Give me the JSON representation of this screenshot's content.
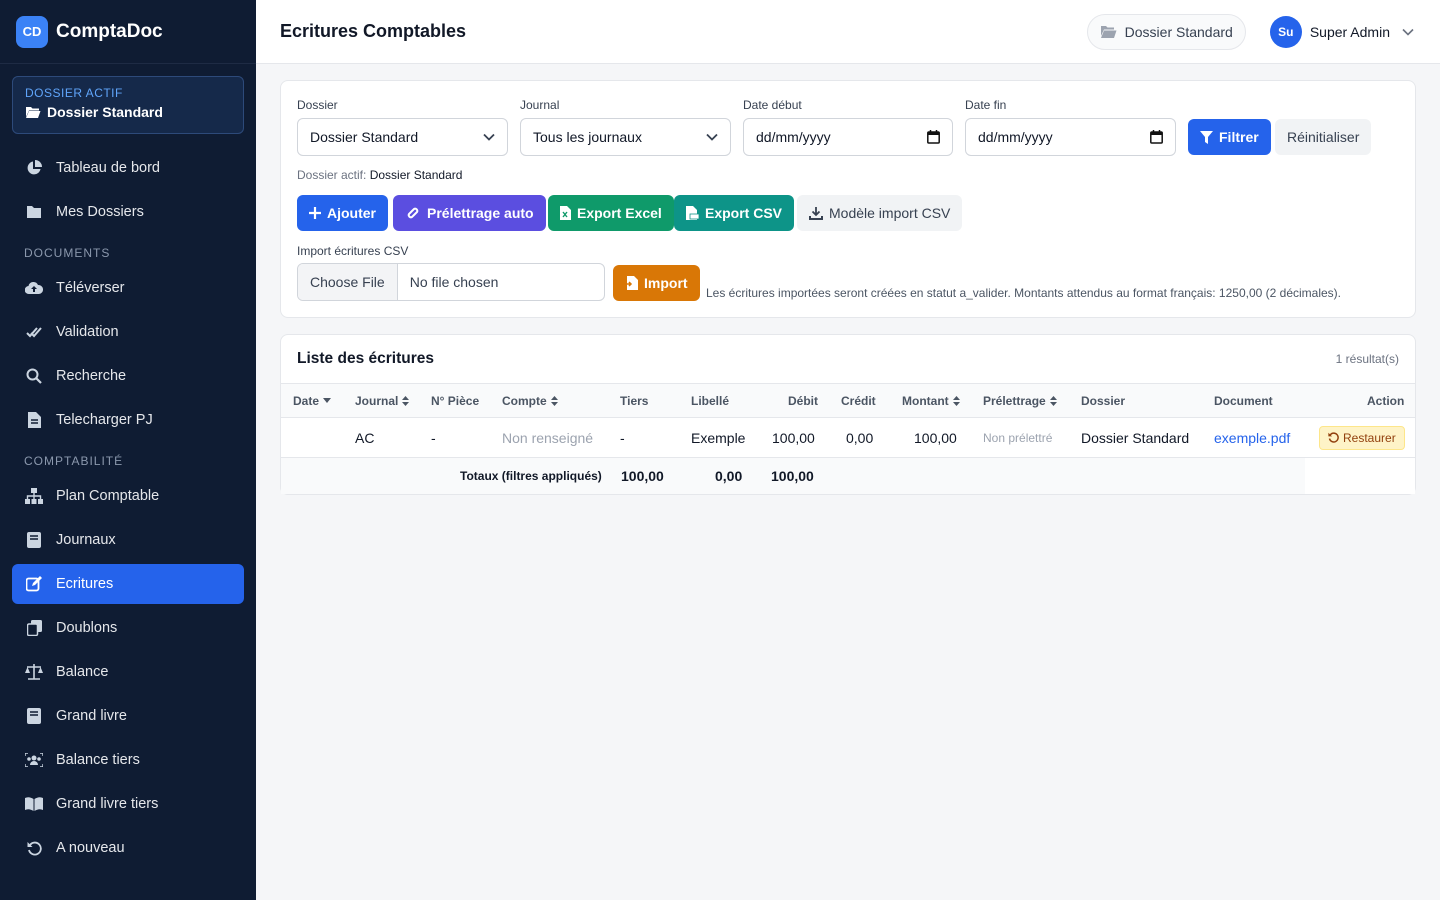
{
  "brand": {
    "logo": "CD",
    "name": "ComptaDoc"
  },
  "active_dossier": {
    "label": "DOSSIER ACTIF",
    "value": "Dossier Standard"
  },
  "sidebar": {
    "items": [
      {
        "label": "Tableau de bord",
        "icon": "pie-chart-icon"
      },
      {
        "label": "Mes Dossiers",
        "icon": "folder-icon"
      },
      {
        "section": "DOCUMENTS"
      },
      {
        "label": "Téléverser",
        "icon": "cloud-upload-icon"
      },
      {
        "label": "Validation",
        "icon": "check-double-icon"
      },
      {
        "label": "Recherche",
        "icon": "search-icon"
      },
      {
        "label": "Telecharger PJ",
        "icon": "file-icon"
      },
      {
        "section": "COMPTABILITÉ"
      },
      {
        "label": "Plan Comptable",
        "icon": "sitemap-icon"
      },
      {
        "label": "Journaux",
        "icon": "book-icon"
      },
      {
        "label": "Ecritures",
        "icon": "edit-icon",
        "active": true
      },
      {
        "label": "Doublons",
        "icon": "copy-icon"
      },
      {
        "label": "Balance",
        "icon": "scale-icon"
      },
      {
        "label": "Grand livre",
        "icon": "book-icon"
      },
      {
        "label": "Balance tiers",
        "icon": "users-icon"
      },
      {
        "label": "Grand livre tiers",
        "icon": "open-book-icon"
      },
      {
        "label": "A nouveau",
        "icon": "undo-icon"
      }
    ]
  },
  "header": {
    "title": "Ecritures Comptables",
    "dossier": "Dossier Standard",
    "user_initials": "Su",
    "user_name": "Super Admin"
  },
  "filters": {
    "dossier_label": "Dossier",
    "dossier_value": "Dossier Standard",
    "journal_label": "Journal",
    "journal_value": "Tous les journaux",
    "date_start_label": "Date début",
    "date_start_value": "dd/mm/yyyy",
    "date_end_label": "Date fin",
    "date_end_value": "dd/mm/yyyy",
    "filter_btn": "Filtrer",
    "reset_btn": "Réinitialiser",
    "helper_prefix": "Dossier actif:",
    "helper_value": "Dossier Standard"
  },
  "actions": {
    "add": "Ajouter",
    "prelettrage": "Prélettrage auto",
    "export_excel": "Export Excel",
    "export_csv": "Export CSV",
    "template_csv": "Modèle import CSV"
  },
  "import": {
    "label": "Import écritures CSV",
    "choose": "Choose File",
    "no_file": "No file chosen",
    "button": "Import",
    "note": "Les écritures importées seront créées en statut a_valider. Montants attendus au format français: 1250,00 (2 décimales)."
  },
  "list": {
    "title": "Liste des écritures",
    "count": "1 résultat(s)",
    "columns": [
      "Date",
      "Journal",
      "N° Pièce",
      "Compte",
      "Tiers",
      "Libellé",
      "Débit",
      "Crédit",
      "Montant",
      "Prélettrage",
      "Dossier",
      "Document",
      "Action"
    ],
    "rows": [
      {
        "date": "",
        "journal": "AC",
        "piece": "-",
        "compte": "Non renseigné",
        "tiers": "-",
        "libelle": "Exemple",
        "debit": "100,00",
        "credit": "0,00",
        "montant": "100,00",
        "prelettrage": "Non prélettré",
        "dossier": "Dossier Standard",
        "document": "exemple.pdf",
        "action": "Restaurer"
      }
    ],
    "totals": {
      "label": "Totaux (filtres appliqués)",
      "debit": "100,00",
      "credit": "0,00",
      "montant": "100,00"
    }
  },
  "colors": {
    "sidebar": "#0f1c33",
    "primary": "#2563eb",
    "purple": "#5b4ee0",
    "green": "#0f9a6a",
    "teal": "#0d9488",
    "orange": "#d97706"
  }
}
